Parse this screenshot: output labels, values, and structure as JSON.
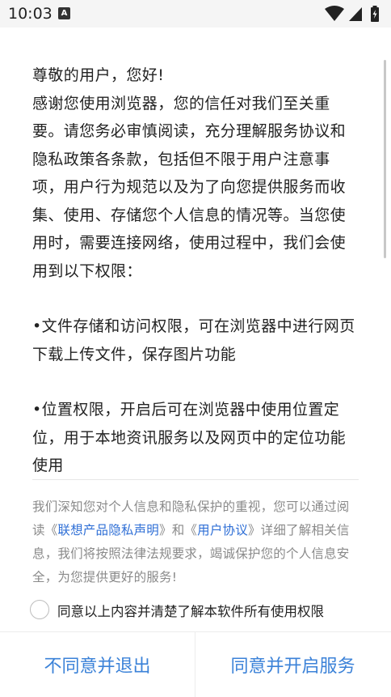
{
  "status_bar": {
    "time": "10:03",
    "notification_icon": "A",
    "icons": [
      "wifi-icon",
      "signal-icon",
      "battery-charging-icon"
    ]
  },
  "dialog": {
    "greeting": "尊敬的用户，您好!",
    "intro": "感谢您使用浏览器，您的信任对我们至关重要。请您务必审慎阅读，充分理解服务协议和隐私政策各条款，包括但不限于用户注意事项，用户行为规范以及为了向您提供服务而收集、使用、存储您个人信息的情况等。当您使用时，需要连接网络，使用过程中，我们会使用到以下权限：",
    "permissions": [
      "•文件存储和访问权限，可在浏览器中进行网页下载上传文件，保存图片功能",
      "•位置权限，开启后可在浏览器中使用位置定位，用于本地资讯服务以及网页中的定位功能使用"
    ],
    "notice": {
      "part1": "我们深知您对个人信息和隐私保护的重视，您可以通过阅读《",
      "privacy_link": "联想产品隐私声明",
      "part2": "》和《",
      "agreement_link": "用户协议",
      "part3": "》详细了解相关信息，我们将按照法律法规要求，竭诚保护您的个人信息安全，为您提供更好的服务!"
    },
    "agree_checkbox_label": "同意以上内容并清楚了解本软件所有使用权限",
    "disagree_button": "不同意并退出",
    "agree_button": "同意并开启服务"
  },
  "colors": {
    "accent": "#3b82d8",
    "link": "#2f6fd6",
    "notice_text": "#8a8a8a"
  }
}
